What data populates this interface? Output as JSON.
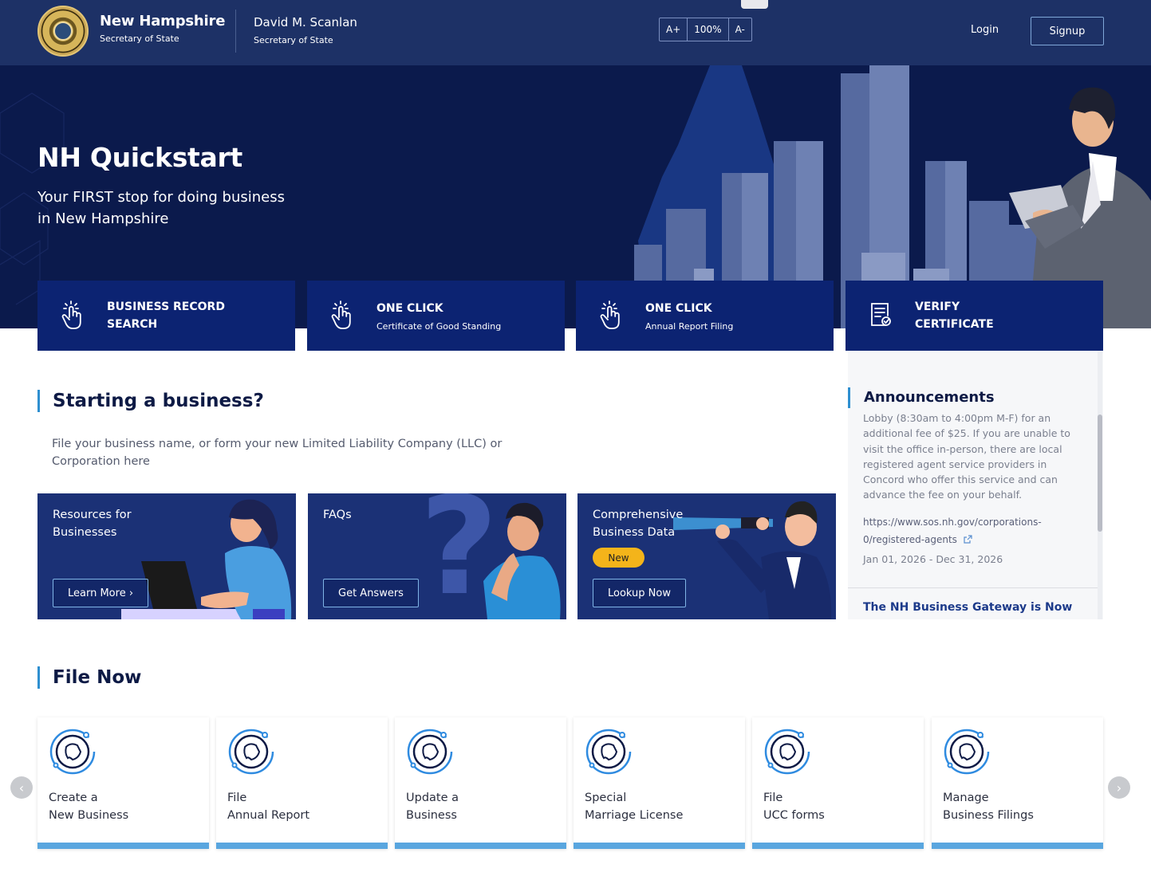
{
  "header": {
    "brand_title": "New Hampshire",
    "brand_subtitle": "Secretary of State",
    "official_name": "David M. Scanlan",
    "official_title": "Secretary of State",
    "font_controls": [
      "A+",
      "100%",
      "A-"
    ],
    "login_label": "Login",
    "signup_label": "Signup"
  },
  "hero": {
    "title": "NH Quickstart",
    "subtitle": "Your FIRST stop for doing business in New Hampshire"
  },
  "quick_cards": [
    {
      "title": "BUSINESS RECORD SEARCH",
      "sub": "",
      "icon": "tap-hand-icon"
    },
    {
      "title": "ONE CLICK",
      "sub": "Certificate of Good Standing",
      "icon": "tap-hand-icon"
    },
    {
      "title": "ONE CLICK",
      "sub": "Annual Report Filing",
      "icon": "tap-hand-icon"
    },
    {
      "title": "VERIFY CERTIFICATE",
      "sub": "",
      "icon": "certificate-icon"
    }
  ],
  "starting": {
    "title": "Starting a business?",
    "description": "File your business name, or form your new Limited Liability Company (LLC) or Corporation here"
  },
  "feature_cards": [
    {
      "label": "Resources for Businesses",
      "button": "Learn More ›"
    },
    {
      "label": "FAQs",
      "button": "Get Answers"
    },
    {
      "label": "Comprehensive Business Data",
      "badge": "New",
      "button": "Lookup Now"
    }
  ],
  "announcements": {
    "title": "Announcements",
    "body": "Lobby (8:30am to 4:00pm M-F) for an additional fee of $25. If you are unable to visit the office in-person, there are local registered agent service providers in Concord who offer this service and can advance the fee on your behalf.",
    "link": "https://www.sos.nh.gov/corporations-0/registered-agents",
    "date": "Jan 01, 2026 - Dec 31, 2026",
    "next_title": "The NH Business Gateway is Now"
  },
  "file_now": {
    "title": "File Now",
    "cards": [
      {
        "line1": "Create a",
        "line2": "New Business"
      },
      {
        "line1": "File",
        "line2": "Annual Report"
      },
      {
        "line1": "Update a",
        "line2": "Business"
      },
      {
        "line1": "Special",
        "line2": "Marriage License"
      },
      {
        "line1": "File",
        "line2": "UCC forms"
      },
      {
        "line1": "Manage",
        "line2": "Business Filings"
      }
    ]
  },
  "colors": {
    "header_bg": "#1d3166",
    "hero_bg": "#0b1a4c",
    "card_bg": "#0c2372",
    "accent": "#2e8fd0",
    "badge": "#f4b41a"
  }
}
